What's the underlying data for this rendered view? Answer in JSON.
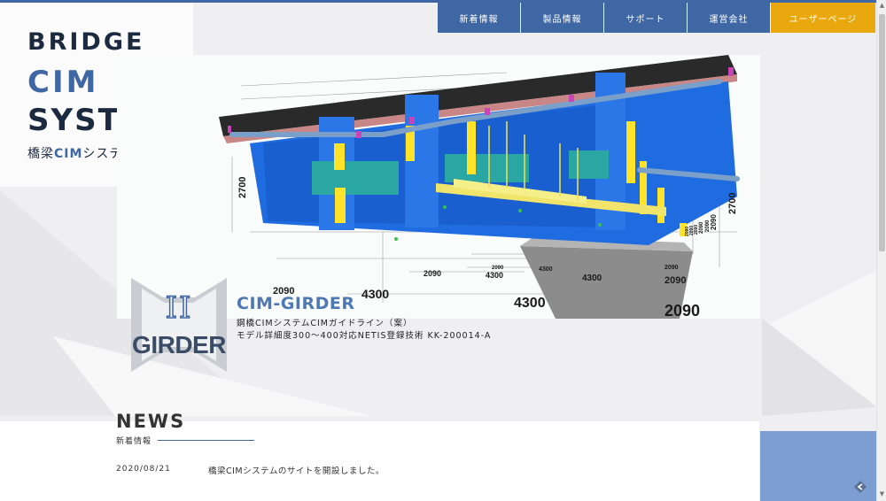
{
  "logo": {
    "line1": "BRIDGE",
    "line2": "CIM",
    "line3": "SYSTEM",
    "jp_prefix": "橋梁",
    "jp_cim": "CIM",
    "jp_suffix": "システム"
  },
  "nav": {
    "items": [
      "新着情報",
      "製品情報",
      "サポート",
      "運営会社",
      "ユーザーページ"
    ]
  },
  "hero": {
    "dimension_labels": [
      "2700",
      "2090",
      "4300",
      "2090",
      "4300",
      "2090",
      "4300",
      "2090",
      "2090",
      "4300",
      "2090",
      "4300",
      "2700",
      "2090",
      "2090",
      "2090",
      "2090",
      "2090",
      "2090"
    ]
  },
  "product": {
    "badge_roman": "II",
    "badge_word": "GIRDER",
    "title": "CIM-GIRDER",
    "line1": "鋼橋CIMシステムCIMガイドライン（案）",
    "line2": "モデル詳細度300～400対応NETIS登録技術 KK-200014-A"
  },
  "news": {
    "title": "NEWS",
    "subtitle": "新着情報",
    "items": [
      {
        "date": "2020/08/21",
        "text": "橋梁CIMシステムのサイトを開設しました。"
      }
    ]
  },
  "colors": {
    "primary": "#3f67a4",
    "accent": "#e8a80e",
    "steel_blue": "#1f6ce0",
    "light_block": "#7c9ed1"
  },
  "icons": {
    "scroll_top": "diamond-arrow-icon"
  }
}
